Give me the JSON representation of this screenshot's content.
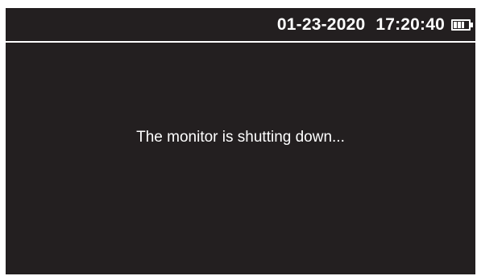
{
  "status_bar": {
    "date": "01-23-2020",
    "time": "17:20:40",
    "battery_icon": "battery-icon",
    "battery_level": 0.75
  },
  "message": "The monitor is shutting down...",
  "colors": {
    "screen_background": "#231f20",
    "foreground": "#ffffff"
  }
}
